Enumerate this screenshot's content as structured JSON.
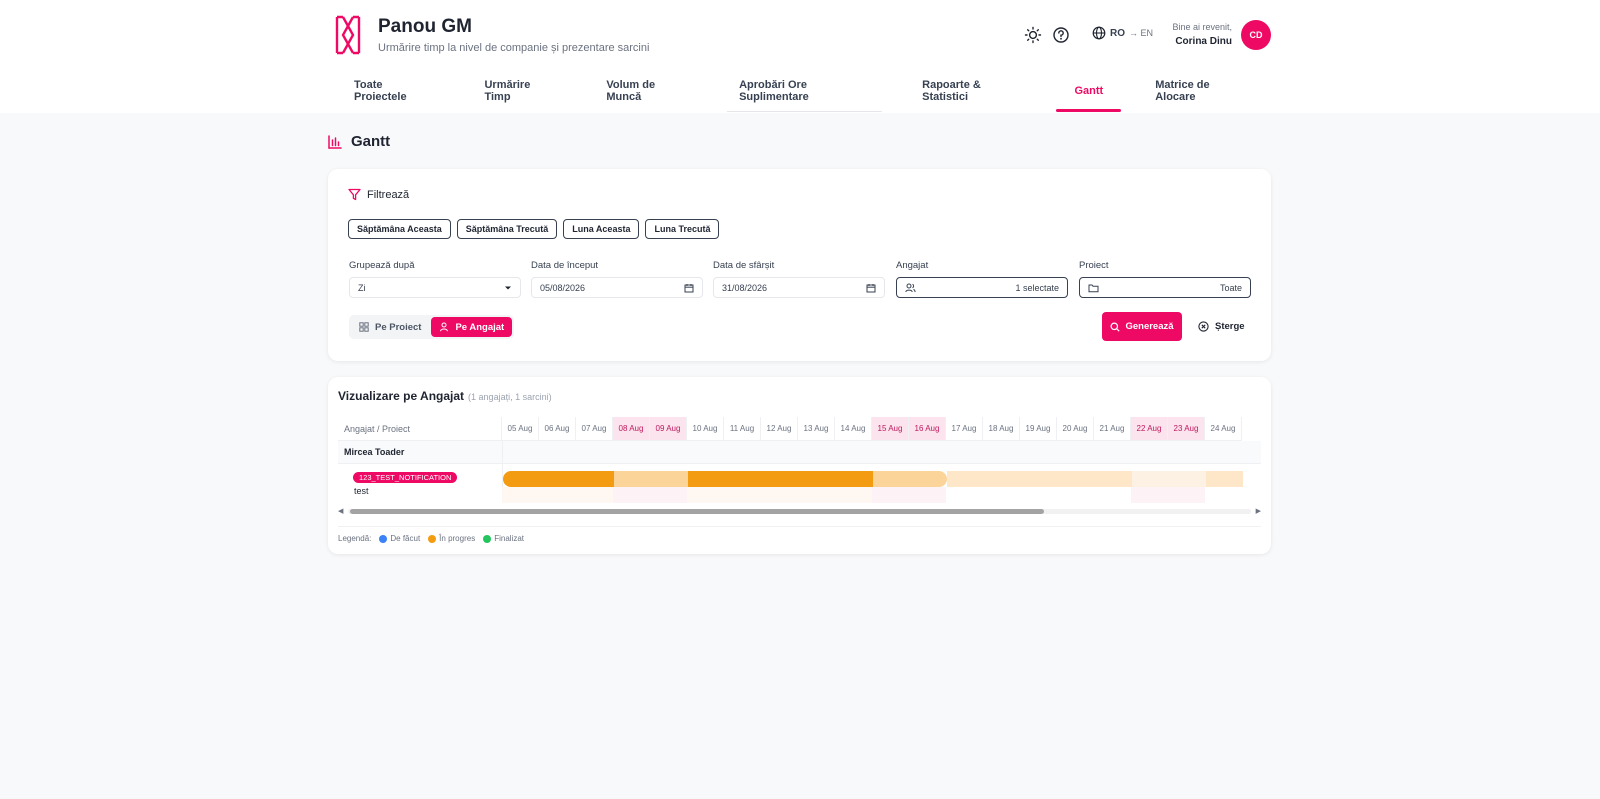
{
  "app": {
    "title": "Panou GM",
    "subtitle": "Urmărire timp la nivel de companie și prezentare sarcini"
  },
  "header": {
    "theme_icon": "sun-icon",
    "help_icon": "help-circle-icon",
    "lang_icon": "globe-icon",
    "lang_current": "RO",
    "lang_switch": "→ EN",
    "welcome": "Bine ai revenit,",
    "user_name": "Corina Dinu",
    "avatar_initials": "CD"
  },
  "tabs": [
    {
      "label": "Toate Proiectele"
    },
    {
      "label": "Urmărire Timp"
    },
    {
      "label": "Volum de Muncă"
    },
    {
      "label": "Aprobări Ore Suplimentare"
    },
    {
      "label": "Rapoarte & Statistici"
    },
    {
      "label": "Gantt"
    },
    {
      "label": "Matrice de Alocare"
    }
  ],
  "active_tab": "Gantt",
  "page": {
    "title": "Gantt",
    "icon": "bar-chart-icon"
  },
  "filter": {
    "title": "Filtrează",
    "quick": [
      "Săptămâna Aceasta",
      "Săptămâna Trecută",
      "Luna Aceasta",
      "Luna Trecută"
    ],
    "group_by": {
      "label": "Grupează după",
      "value": "Zi"
    },
    "start_date": {
      "label": "Data de început",
      "value": "05/08/2026"
    },
    "end_date": {
      "label": "Data de sfârșit",
      "value": "31/08/2026"
    },
    "employee": {
      "label": "Angajat",
      "value": "1 selectate"
    },
    "project": {
      "label": "Proiect",
      "value": "Toate"
    },
    "mode_project": "Pe Proiect",
    "mode_employee": "Pe Angajat",
    "generate": "Generează",
    "clear": "Șterge"
  },
  "gantt": {
    "title": "Vizualizare pe Angajat",
    "subtitle": "(1 angajați, 1 sarcini)",
    "first_col": "Angajat / Proiect",
    "days": [
      "05 Aug",
      "06 Aug",
      "07 Aug",
      "08 Aug",
      "09 Aug",
      "10 Aug",
      "11 Aug",
      "12 Aug",
      "13 Aug",
      "14 Aug",
      "15 Aug",
      "16 Aug",
      "17 Aug",
      "18 Aug",
      "19 Aug",
      "20 Aug",
      "21 Aug",
      "22 Aug",
      "23 Aug",
      "24 Aug"
    ],
    "weekend_days": [
      "08 Aug",
      "09 Aug",
      "15 Aug",
      "16 Aug",
      "22 Aug",
      "23 Aug"
    ],
    "employee": "Mircea Toader",
    "project_tag": "123_TEST_NOTIFICATION",
    "task": "test",
    "bar_color": "#f39c12"
  },
  "legend": {
    "label": "Legendă:",
    "items": [
      {
        "label": "De făcut",
        "color": "#3b82f6"
      },
      {
        "label": "În progres",
        "color": "#f39c12"
      },
      {
        "label": "Finalizat",
        "color": "#22c55e"
      }
    ]
  },
  "colors": {
    "accent": "#ee0a64"
  }
}
